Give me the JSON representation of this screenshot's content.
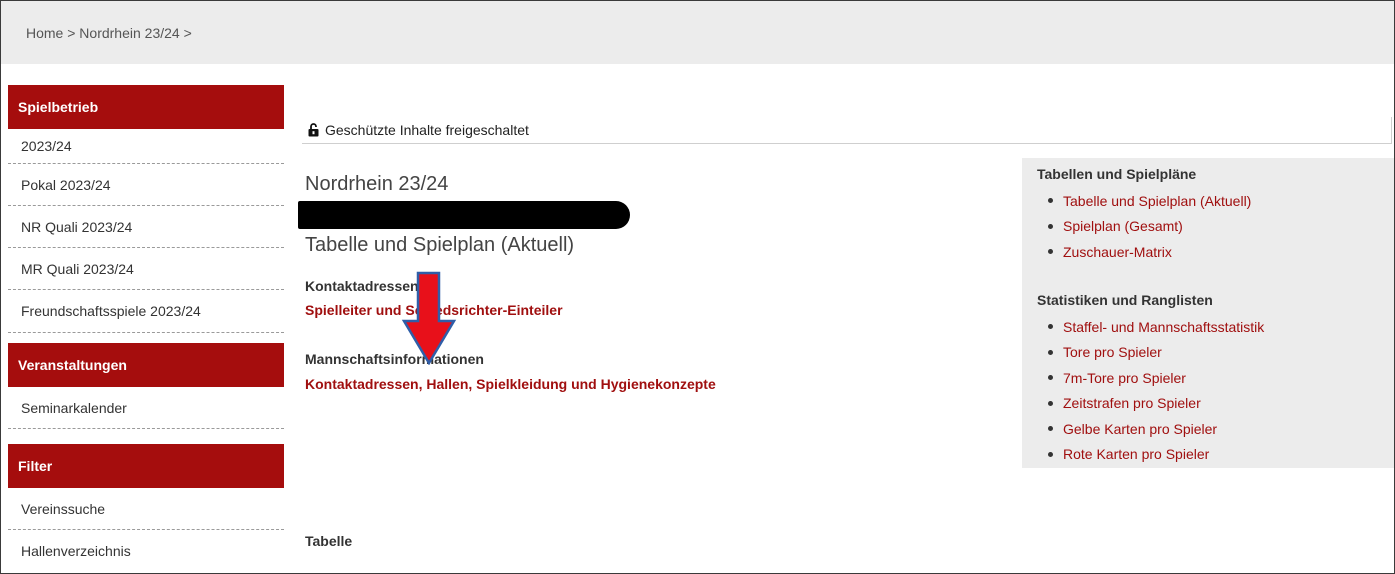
{
  "breadcrumb": {
    "text": "Home > Nordrhein 23/24 >"
  },
  "sidebar": {
    "sections": [
      {
        "header": "Spielbetrieb",
        "items": [
          "2023/24",
          "Pokal 2023/24",
          "NR Quali 2023/24",
          "MR Quali 2023/24",
          "Freundschaftsspiele 2023/24"
        ]
      },
      {
        "header": "Veranstaltungen",
        "items": [
          "Seminarkalender"
        ]
      },
      {
        "header": "Filter",
        "items": [
          "Vereinssuche",
          "Hallenverzeichnis"
        ]
      }
    ]
  },
  "main": {
    "lock_status": "Geschützte Inhalte freigeschaltet",
    "league_title": "Nordrhein 23/24",
    "page_title": "Tabelle und Spielplan (Aktuell)",
    "contacts_heading": "Kontaktadressen",
    "contacts_link": "Spielleiter und Schiedsrichter-Einteiler",
    "team_info_heading": "Mannschaftsinformationen",
    "team_info_link": "Kontaktadressen, Hallen, Spielkleidung und Hygienekonzepte",
    "table_heading": "Tabelle"
  },
  "right_box": {
    "schedules_heading": "Tabellen und Spielpläne",
    "schedules_links": [
      "Tabelle und Spielplan (Aktuell)",
      "Spielplan (Gesamt)",
      "Zuschauer-Matrix"
    ],
    "stats_heading": "Statistiken und Ranglisten",
    "stats_links": [
      "Staffel- und Mannschaftsstatistik",
      "Tore pro Spieler",
      "7m-Tore pro Spieler",
      "Zeitstrafen pro Spieler",
      "Gelbe Karten pro Spieler",
      "Rote Karten pro Spieler"
    ]
  },
  "icons": {
    "lock": "unlocked-padlock-icon",
    "arrow": "down-arrow-icon"
  },
  "colors": {
    "accent": "#a50d0d",
    "link": "#a00f0f",
    "panel": "#ececec",
    "arrow_fill": "#e8101a",
    "arrow_outline": "#2f5ea8"
  }
}
